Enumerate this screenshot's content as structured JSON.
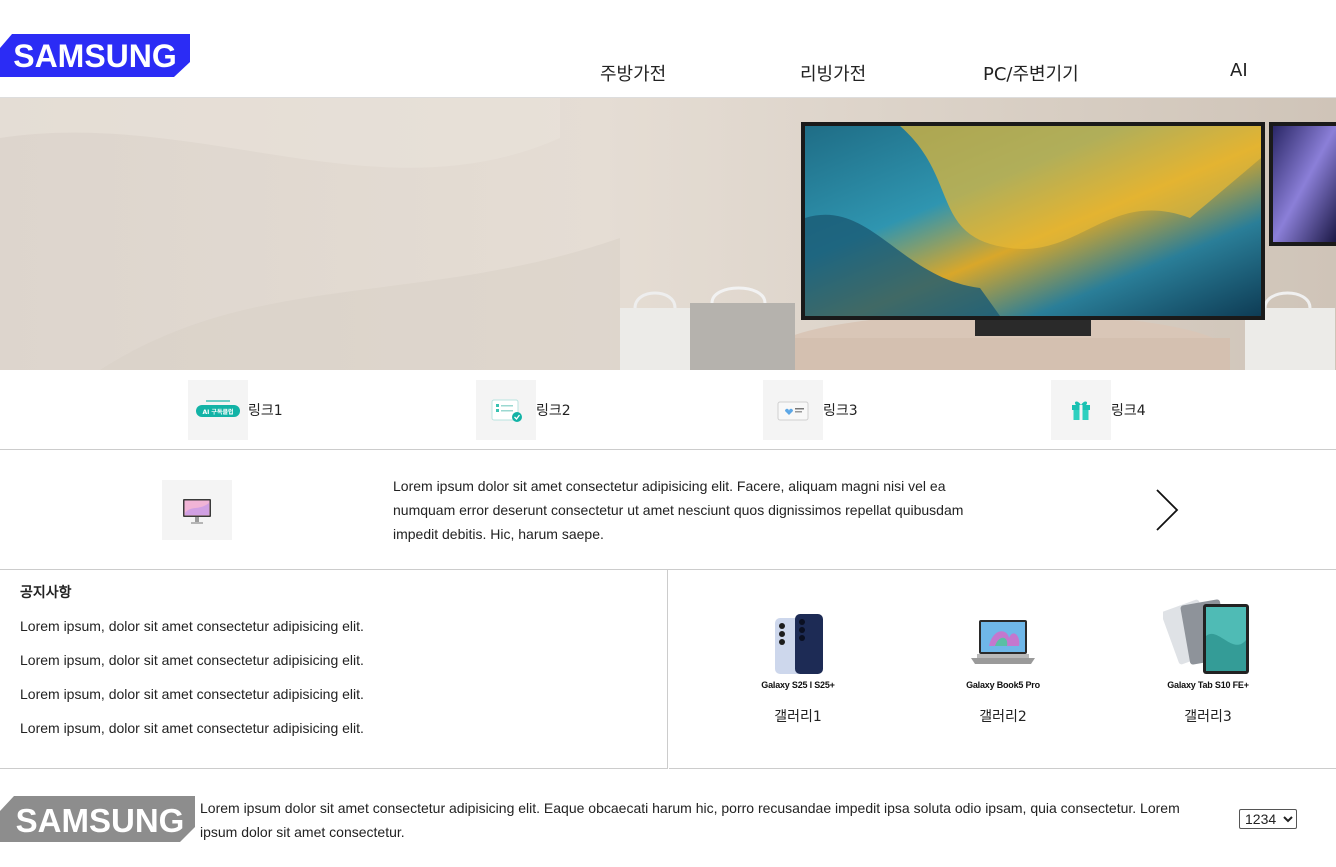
{
  "brand": {
    "logo_text": "SAMSUNG",
    "logo_color": "#1428f0"
  },
  "nav": {
    "items": [
      {
        "label": "주방가전"
      },
      {
        "label": "리빙가전"
      },
      {
        "label": "PC/주변기기"
      },
      {
        "label": "AI"
      }
    ]
  },
  "links": [
    {
      "label": "링크1",
      "icon": "ai-subscription-badge-icon",
      "badge_text": "AI 구독클럽"
    },
    {
      "label": "링크2",
      "icon": "checklist-icon"
    },
    {
      "label": "링크3",
      "icon": "samsung-care-card-icon"
    },
    {
      "label": "링크4",
      "icon": "gift-icon"
    }
  ],
  "promo": {
    "text": "Lorem ipsum dolor sit amet consectetur adipisicing elit. Facere, aliquam magni nisi vel ea numquam error deserunt consectetur ut amet nesciunt quos dignissimos repellat quibusdam impedit debitis. Hic, harum saepe.",
    "icon": "monitor-icon"
  },
  "notice": {
    "title": "공지사항",
    "items": [
      "Lorem ipsum, dolor sit amet consectetur adipisicing elit.",
      "Lorem ipsum, dolor sit amet consectetur adipisicing elit.",
      "Lorem ipsum, dolor sit amet consectetur adipisicing elit.",
      "Lorem ipsum, dolor sit amet consectetur adipisicing elit."
    ]
  },
  "gallery": [
    {
      "caption": "Galaxy S25 l S25+",
      "label": "갤러리1",
      "icon": "smartphones-icon"
    },
    {
      "caption": "Galaxy Book5 Pro",
      "label": "갤러리2",
      "icon": "laptop-icon"
    },
    {
      "caption": "Galaxy Tab S10 FE+",
      "label": "갤러리3",
      "icon": "tablets-icon"
    }
  ],
  "footer": {
    "logo_text": "SAMSUNG",
    "text": "Lorem ipsum dolor sit amet consectetur adipisicing elit. Eaque obcaecati harum hic, porro recusandae impedit ipsa soluta odio ipsam, quia consectetur. Lorem ipsum dolor sit amet consectetur.",
    "select_value": "1234",
    "select_options": [
      "1234"
    ]
  }
}
